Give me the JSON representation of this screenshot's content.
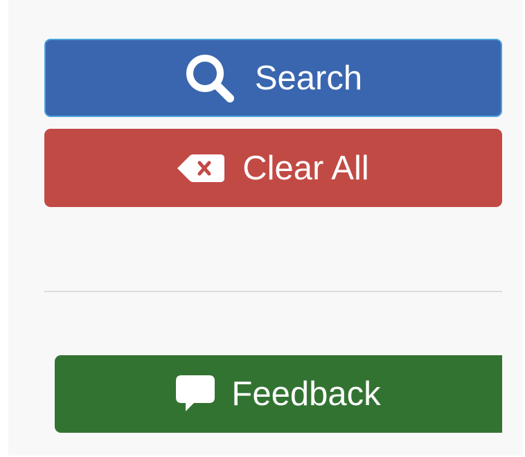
{
  "sidebar": {
    "search_button": {
      "label": "Search",
      "icon": "search-icon",
      "color": "#3a66af"
    },
    "clear_button": {
      "label": "Clear All",
      "icon": "backspace-icon",
      "color": "#c14a45"
    },
    "feedback_button": {
      "label": "Feedback",
      "icon": "comment-icon",
      "color": "#337332"
    }
  }
}
